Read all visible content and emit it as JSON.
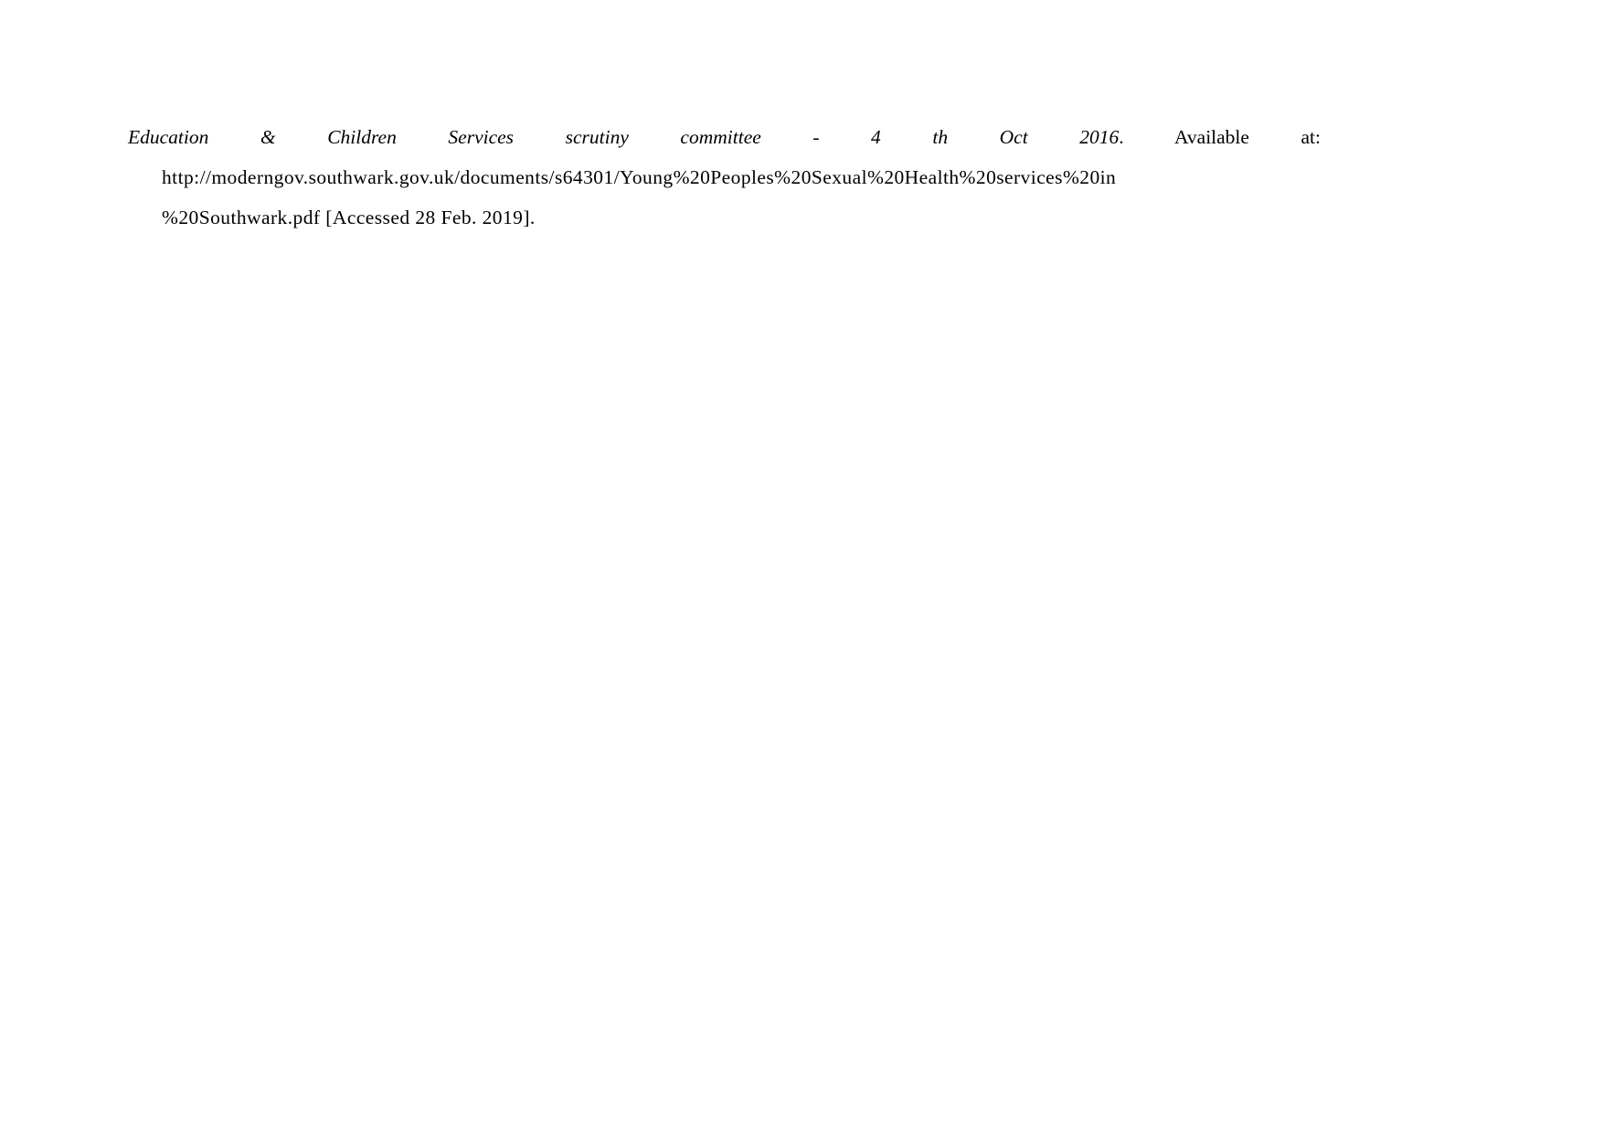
{
  "page": {
    "background_color": "#ffffff",
    "text_color": "#000000"
  },
  "reference": {
    "line1": {
      "title_part1": "Education",
      "title_ampersand": "&",
      "title_part2": "Children",
      "title_part3": "Services",
      "title_part4": "scrutiny",
      "title_part5": "committee",
      "title_dash": "-",
      "title_day": "4",
      "title_ordinal": "th",
      "title_month": "Oct",
      "title_year": "2016",
      "period": ".",
      "available_label": "Available",
      "at_label": "at:"
    },
    "line2": {
      "url_segment": "http://moderngov.southwark.gov.uk/documents/s64301/Young%20Peoples%20Sexual%20Health%20services%20in"
    },
    "line3": {
      "url_tail": "%20Southwark.pdf",
      "accessed_note": "[Accessed 28 Feb. 2019]."
    },
    "full_text": "Education & Children Services scrutiny committee - 4 th Oct 2016. Available at: http://moderngov.southwark.gov.uk/documents/s64301/Young%20Peoples%20Sexual%20Health%20services%20in%20Southwark.pdf [Accessed 28 Feb. 2019]."
  }
}
